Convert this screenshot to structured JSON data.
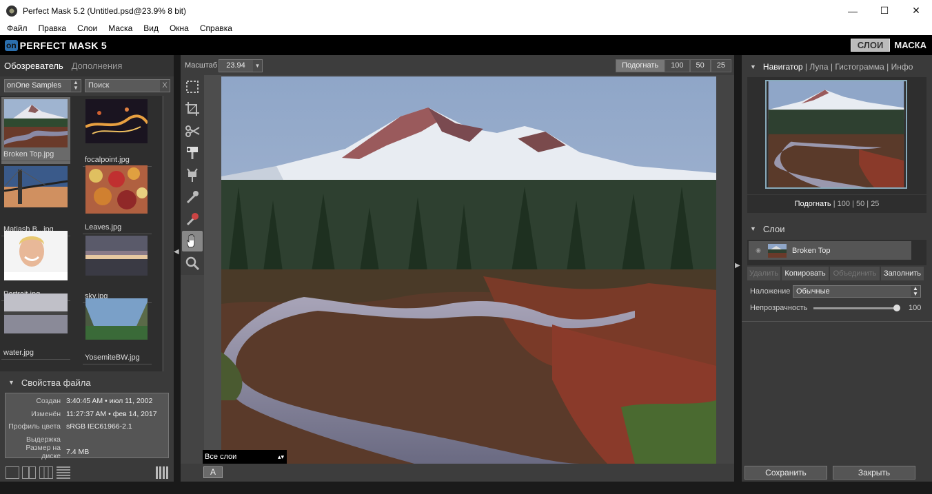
{
  "window": {
    "title": "Perfect Mask 5.2 (Untitled.psd@23.9% 8 bit)",
    "minimize": "—",
    "maximize": "☐",
    "close": "✕"
  },
  "menu": [
    "Файл",
    "Правка",
    "Слои",
    "Маска",
    "Вид",
    "Окна",
    "Справка"
  ],
  "brand": {
    "mark": "on",
    "name": "PERFECT MASK 5",
    "mode_layers": "СЛОИ",
    "mode_mask": "МАСКА"
  },
  "left": {
    "tabs": [
      "Обозреватель",
      "Дополнения"
    ],
    "source": "onOne Samples",
    "search_placeholder": "Поиск",
    "thumbs": [
      {
        "label": "Broken Top.jpg",
        "selected": true
      },
      {
        "label": "focalpoint.jpg"
      },
      {
        "label": "Matiash B...jpg"
      },
      {
        "label": "Leaves.jpg"
      },
      {
        "label": "Portrait.jpg"
      },
      {
        "label": "sky.jpg"
      },
      {
        "label": "water.jpg"
      },
      {
        "label": "YosemiteBW.jpg"
      }
    ],
    "file_props_title": "Свойства файла",
    "file_props": [
      {
        "k": "Создан",
        "v": "3:40:45 AM • июл 11, 2002"
      },
      {
        "k": "Изменён",
        "v": "11:27:37 AM • фев 14, 2017"
      },
      {
        "k": "Профиль цвета",
        "v": "sRGB IEC61966-2.1"
      },
      {
        "k": "Выдержка",
        "v": ""
      },
      {
        "k": "Размер на диске",
        "v": "7.4 MB"
      }
    ]
  },
  "center": {
    "zoom_label": "Масштаб",
    "zoom_value": "23.94",
    "zoom_buttons": [
      "Подогнать",
      "100",
      "50",
      "25"
    ],
    "layer_select": "Все слои",
    "btn_a": "A"
  },
  "right": {
    "nav_tabs": [
      "Навигатор",
      "Лупа",
      "Гистограмма",
      "Инфо"
    ],
    "nav_zoom": [
      "Подогнать",
      "100",
      "50",
      "25"
    ],
    "layers_title": "Слои",
    "layer_name": "Broken Top",
    "layer_buttons": [
      {
        "label": "Удалить",
        "disabled": true
      },
      {
        "label": "Копировать",
        "disabled": false
      },
      {
        "label": "Объединить",
        "disabled": true
      },
      {
        "label": "Заполнить",
        "disabled": false
      }
    ],
    "blend_label": "Наложение",
    "blend_value": "Обычные",
    "opacity_label": "Непрозрачность",
    "opacity_value": "100",
    "save": "Сохранить",
    "close": "Закрыть"
  }
}
